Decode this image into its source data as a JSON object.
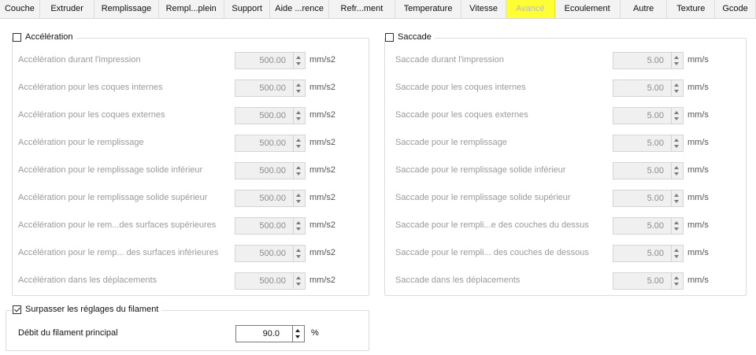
{
  "tabs": [
    {
      "label": "Couche",
      "width": 52
    },
    {
      "label": "Extruder",
      "width": 71
    },
    {
      "label": "Remplissage",
      "width": 83
    },
    {
      "label": "Rempl...plein",
      "width": 85
    },
    {
      "label": "Support",
      "width": 60
    },
    {
      "label": "Aide ...rence",
      "width": 76
    },
    {
      "label": "Refr...ment",
      "width": 86
    },
    {
      "label": "Temperature",
      "width": 86
    },
    {
      "label": "Vitesse",
      "width": 58
    },
    {
      "label": "Avancé",
      "width": 63,
      "active": true
    },
    {
      "label": "Ecoulement",
      "width": 85
    },
    {
      "label": "Autre",
      "width": 61
    },
    {
      "label": "Texture",
      "width": 62
    },
    {
      "label": "Gcode",
      "width": 53
    }
  ],
  "acceleration": {
    "title": "Accélération",
    "checked": false,
    "rows": [
      {
        "label": "Accélération durant l'impression",
        "value": "500.00",
        "unit": "mm/s2"
      },
      {
        "label": "Accélération pour les coques internes",
        "value": "500.00",
        "unit": "mm/s2"
      },
      {
        "label": "Accélération pour les coques externes",
        "value": "500.00",
        "unit": "mm/s2"
      },
      {
        "label": "Accélération pour le remplissage",
        "value": "500.00",
        "unit": "mm/s2"
      },
      {
        "label": "Accélération pour le remplissage solide inférieur",
        "value": "500.00",
        "unit": "mm/s2"
      },
      {
        "label": "Accélération pour le remplissage solide supérieur",
        "value": "500.00",
        "unit": "mm/s2"
      },
      {
        "label": "Accélération pour le rem...des surfaces supérieures",
        "value": "500.00",
        "unit": "mm/s2"
      },
      {
        "label": "Accélération pour le remp... des surfaces inférieures",
        "value": "500.00",
        "unit": "mm/s2"
      },
      {
        "label": "Accélération dans les déplacements",
        "value": "500.00",
        "unit": "mm/s2"
      }
    ]
  },
  "jerk": {
    "title": "Saccade",
    "checked": false,
    "rows": [
      {
        "label": "Saccade durant l'impression",
        "value": "5.00",
        "unit": "mm/s"
      },
      {
        "label": "Saccade pour les coques internes",
        "value": "5.00",
        "unit": "mm/s"
      },
      {
        "label": "Saccade pour les coques externes",
        "value": "5.00",
        "unit": "mm/s"
      },
      {
        "label": "Saccade pour le remplissage",
        "value": "5.00",
        "unit": "mm/s"
      },
      {
        "label": "Saccade pour le remplissage solide inférieur",
        "value": "5.00",
        "unit": "mm/s"
      },
      {
        "label": "Saccade pour le remplissage solide supérieur",
        "value": "5.00",
        "unit": "mm/s"
      },
      {
        "label": "Saccade pour le rempli...e des couches du dessus",
        "value": "5.00",
        "unit": "mm/s"
      },
      {
        "label": "Saccade pour le rempli... des couches de dessous",
        "value": "5.00",
        "unit": "mm/s"
      },
      {
        "label": "Saccade dans les déplacements",
        "value": "5.00",
        "unit": "mm/s"
      }
    ]
  },
  "filament_override": {
    "title": "Surpasser les réglages du filament",
    "checked": true,
    "flow_label": "Débit du filament principal",
    "flow_value": "90.0",
    "flow_unit": "%"
  }
}
